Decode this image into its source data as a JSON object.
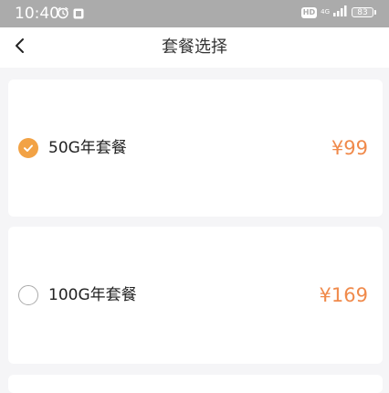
{
  "status_bar": {
    "time": "10:40",
    "network_top": "4G",
    "network_bottom": "⁴ᴳ",
    "hd_label": "HD",
    "battery": "83"
  },
  "nav": {
    "title": "套餐选择",
    "back_icon": "chevron-left-icon"
  },
  "plans": [
    {
      "name": "50G年套餐",
      "price": "¥99",
      "selected": true
    },
    {
      "name": "100G年套餐",
      "price": "¥169",
      "selected": false
    }
  ],
  "colors": {
    "accent": "#f2a245",
    "price": "#f08a4b",
    "status_bar": "#ababab",
    "page_bg": "#f5f5f7"
  }
}
